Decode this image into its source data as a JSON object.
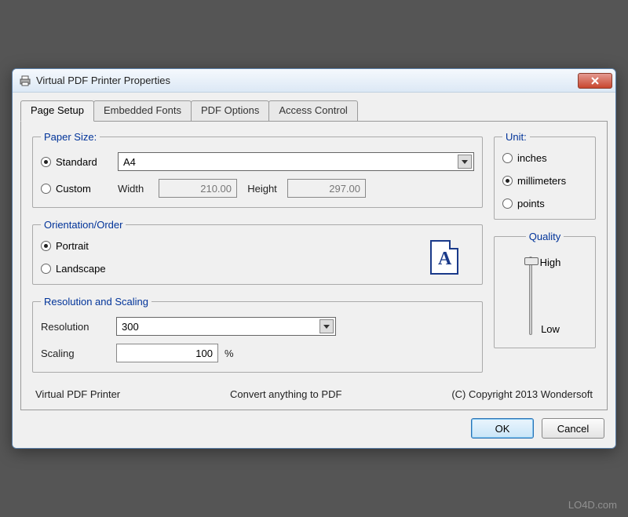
{
  "title": "Virtual PDF Printer Properties",
  "tabs": [
    "Page Setup",
    "Embedded Fonts",
    "PDF Options",
    "Access Control"
  ],
  "paperSize": {
    "legend": "Paper Size:",
    "standardLabel": "Standard",
    "customLabel": "Custom",
    "selected": "A4",
    "widthLabel": "Width",
    "widthValue": "210.00",
    "heightLabel": "Height",
    "heightValue": "297.00"
  },
  "orientation": {
    "legend": "Orientation/Order",
    "portraitLabel": "Portrait",
    "landscapeLabel": "Landscape"
  },
  "resolution": {
    "legend": "Resolution and Scaling",
    "resLabel": "Resolution",
    "resValue": "300",
    "scalingLabel": "Scaling",
    "scalingValue": "100",
    "percent": "%"
  },
  "unit": {
    "legend": "Unit:",
    "inchesLabel": "inches",
    "mmLabel": "millimeters",
    "pointsLabel": "points"
  },
  "quality": {
    "legend": "Quality",
    "highLabel": "High",
    "lowLabel": "Low"
  },
  "footer": {
    "product": "Virtual PDF Printer",
    "tagline": "Convert anything to PDF",
    "copyright": "(C) Copyright 2013 Wondersoft"
  },
  "buttons": {
    "ok": "OK",
    "cancel": "Cancel"
  },
  "watermark": "LO4D.com"
}
